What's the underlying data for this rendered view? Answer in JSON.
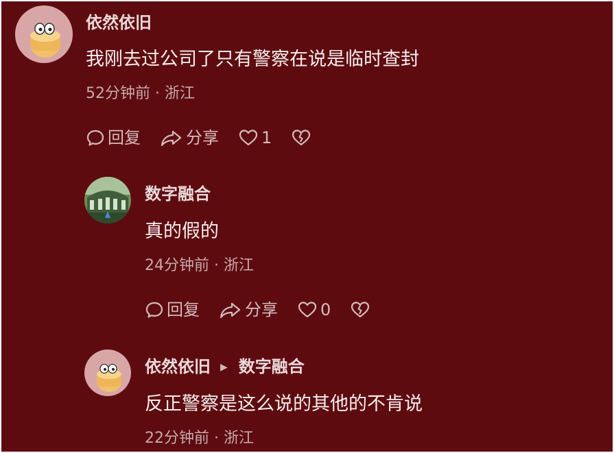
{
  "colors": {
    "background": "#5e0b10",
    "name_text": "#ead9da",
    "body_text": "#f6eeee",
    "meta_text": "#c7aaac",
    "action_text": "#d4bcbe"
  },
  "comments": [
    {
      "author": "依然依旧",
      "avatar_icon": "cartoon-avatar-icon",
      "text": "我刚去过公司了只有警察在说是临时查封",
      "meta": "52分钟前 · 浙江",
      "actions": {
        "reply": "回复",
        "share": "分享",
        "like_count": "1"
      }
    },
    {
      "author": "数字融合",
      "avatar_icon": "building-avatar-icon",
      "text": "真的假的",
      "meta": "24分钟前 · 浙江",
      "actions": {
        "reply": "回复",
        "share": "分享",
        "like_count": "0"
      }
    },
    {
      "author": "依然依旧",
      "reply_to": "数字融合",
      "avatar_icon": "cartoon-avatar-icon",
      "text": "反正警察是这么说的其他的不肯说",
      "meta": "22分钟前 · 浙江"
    }
  ]
}
